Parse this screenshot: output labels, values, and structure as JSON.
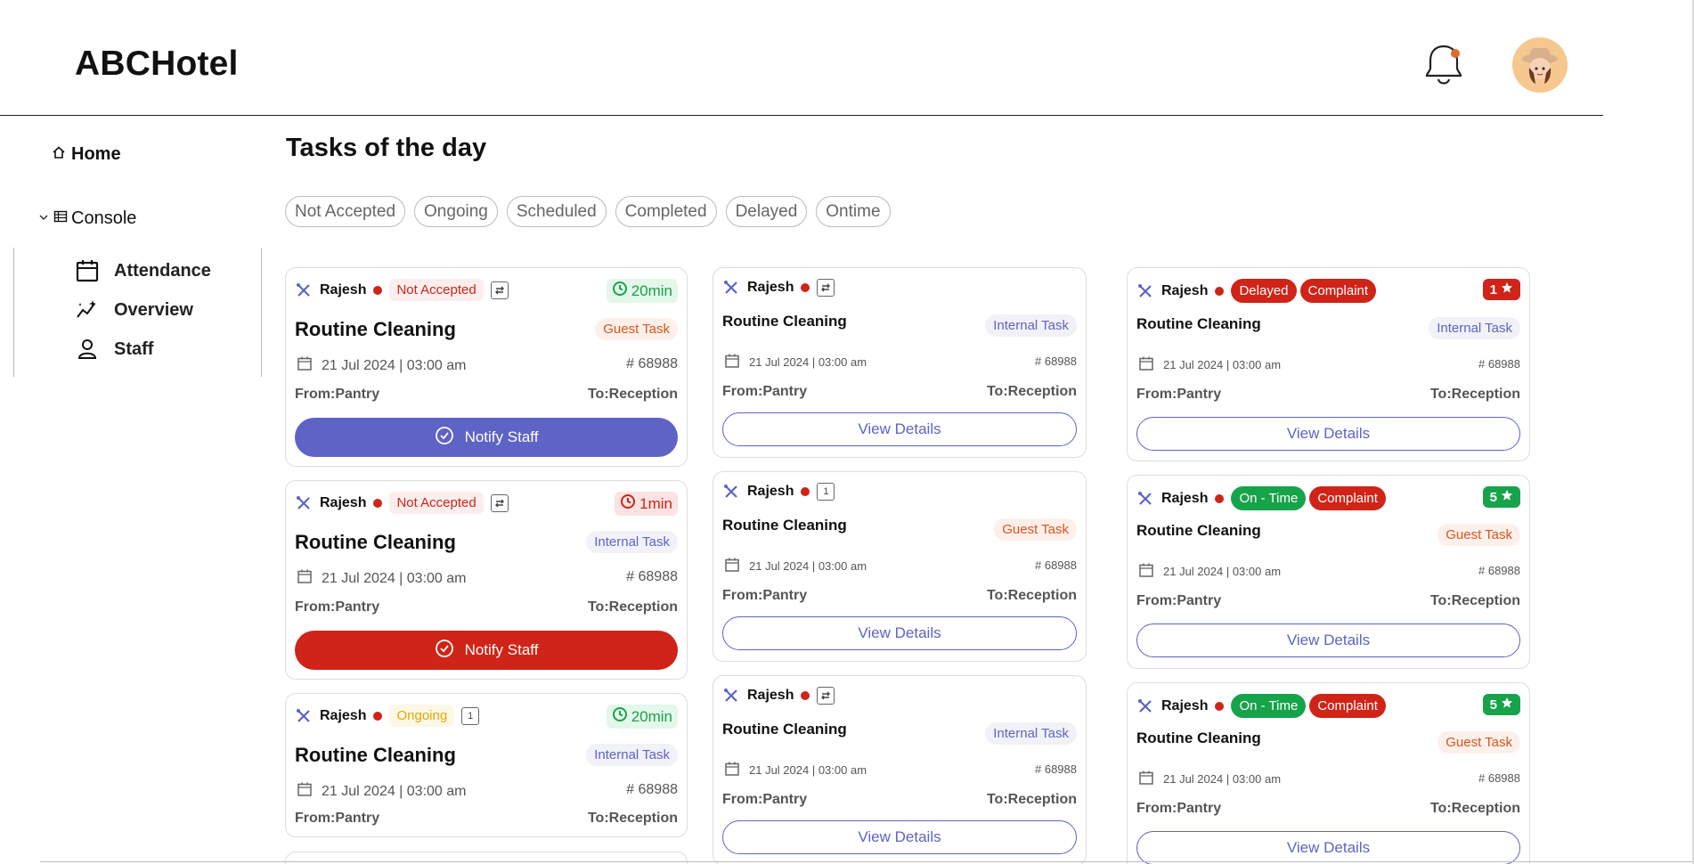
{
  "header": {
    "logo": "ABCHotel",
    "bell_icon": "bell-icon",
    "avatar_icon": "user-avatar"
  },
  "sidebar": {
    "home": {
      "label": "Home",
      "icon": "home-icon"
    },
    "console": {
      "label": "Console",
      "icon": "table-icon",
      "expanded": true
    },
    "items": [
      {
        "label": "Attendance",
        "icon": "calendar-icon"
      },
      {
        "label": "Overview",
        "icon": "sparkle-icon"
      },
      {
        "label": "Staff",
        "icon": "person-icon"
      }
    ]
  },
  "main": {
    "title": "Tasks of the day",
    "filters": [
      "Not Accepted",
      "Ongoing",
      "Scheduled",
      "Completed",
      "Delayed",
      "Ontime"
    ]
  },
  "colors": {
    "primary": "#5e63c6",
    "danger": "#cf2417",
    "success": "#17a34a",
    "warning": "#e0a800",
    "guest_tag": "#d9541e"
  },
  "cards": {
    "col1": [
      {
        "name": "Rajesh",
        "status": "Not Accepted",
        "timer": "20min",
        "title": "Routine Cleaning",
        "tag": "Guest Task",
        "date": "21 Jul 2024 | 03:00 am",
        "id": "# 68988",
        "from": "From:Pantry",
        "to": "To:Reception",
        "button": "Notify Staff"
      },
      {
        "name": "Rajesh",
        "status": "Not Accepted",
        "timer": "1min",
        "title": "Routine Cleaning",
        "tag": "Internal Task",
        "date": "21 Jul 2024 | 03:00 am",
        "id": "# 68988",
        "from": "From:Pantry",
        "to": "To:Reception",
        "button": "Notify Staff"
      },
      {
        "name": "Rajesh",
        "status": "Ongoing",
        "timer": "20min",
        "title": "Routine Cleaning",
        "tag": "Internal Task",
        "date": "21 Jul 2024 | 03:00 am",
        "id": "# 68988",
        "from": "From:Pantry",
        "to": "To:Reception"
      }
    ],
    "col2": [
      {
        "name": "Rajesh",
        "title": "Routine Cleaning",
        "tag": "Internal Task",
        "date": "21 Jul 2024 | 03:00 am",
        "id": "# 68988",
        "from": "From:Pantry",
        "to": "To:Reception",
        "button": "View Details"
      },
      {
        "name": "Rajesh",
        "title": "Routine Cleaning",
        "tag": "Guest Task",
        "date": "21 Jul 2024 | 03:00 am",
        "id": "# 68988",
        "from": "From:Pantry",
        "to": "To:Reception",
        "button": "View Details",
        "mini_icon": "1"
      },
      {
        "name": "Rajesh",
        "title": "Routine Cleaning",
        "tag": "Internal Task",
        "date": "21 Jul 2024 | 03:00 am",
        "id": "# 68988",
        "from": "From:Pantry",
        "to": "To:Reception",
        "button": "View Details"
      }
    ],
    "col3": [
      {
        "name": "Rajesh",
        "status": "Delayed",
        "complaint": "Complaint",
        "rating": "1",
        "title": "Routine Cleaning",
        "tag": "Internal Task",
        "date": "21 Jul 2024 | 03:00 am",
        "id": "# 68988",
        "from": "From:Pantry",
        "to": "To:Reception",
        "button": "View Details"
      },
      {
        "name": "Rajesh",
        "status": "On - Time",
        "complaint": "Complaint",
        "rating": "5",
        "title": "Routine Cleaning",
        "tag": "Guest Task",
        "date": "21 Jul 2024 | 03:00 am",
        "id": "# 68988",
        "from": "From:Pantry",
        "to": "To:Reception",
        "button": "View Details"
      },
      {
        "name": "Rajesh",
        "status": "On - Time",
        "complaint": "Complaint",
        "rating": "5",
        "title": "Routine Cleaning",
        "tag": "Guest Task",
        "date": "21 Jul 2024 | 03:00 am",
        "id": "# 68988",
        "from": "From:Pantry",
        "to": "To:Reception",
        "button": "View Details"
      }
    ],
    "col1_extra_mini_icon": "1"
  }
}
